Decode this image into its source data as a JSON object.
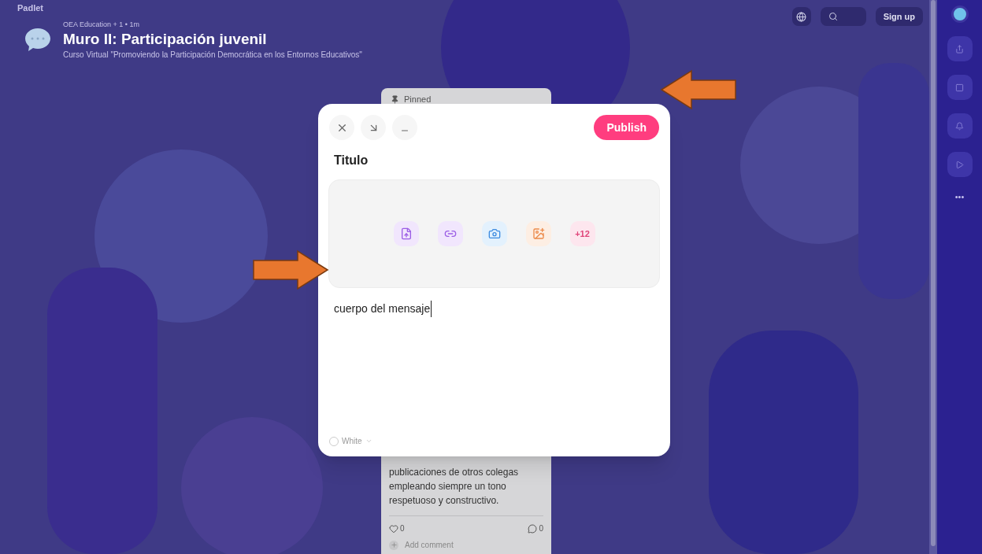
{
  "brand": "Padlet",
  "header": {
    "meta": "OEA Education + 1 • 1m",
    "title": "Muro II: Participación juvenil",
    "subtitle": "Curso Virtual \"Promoviendo la Participación Democrática en los Entornos Educativos\""
  },
  "top_bar": {
    "signup": "Sign up"
  },
  "sidebar": {
    "items": [
      {
        "kind": "share"
      },
      {
        "kind": "embed"
      },
      {
        "kind": "bell"
      },
      {
        "kind": "play"
      }
    ],
    "more": "•••"
  },
  "card": {
    "pinned": "Pinned",
    "body": "publicaciones de otros colegas empleando siempre un tono respetuoso y constructivo.",
    "likes": "0",
    "comments": "0",
    "add_comment": "Add comment"
  },
  "composer": {
    "publish": "Publish",
    "title": "Titulo",
    "attachments": [
      {
        "kind": "upload"
      },
      {
        "kind": "link"
      },
      {
        "kind": "camera"
      },
      {
        "kind": "image-search"
      },
      {
        "kind": "more",
        "label": "+12"
      }
    ],
    "body": "cuerpo del mensaje",
    "color_label": "White",
    "color": "#ffffff"
  },
  "annotations": [
    {
      "kind": "arrow-left"
    },
    {
      "kind": "arrow-right"
    }
  ]
}
